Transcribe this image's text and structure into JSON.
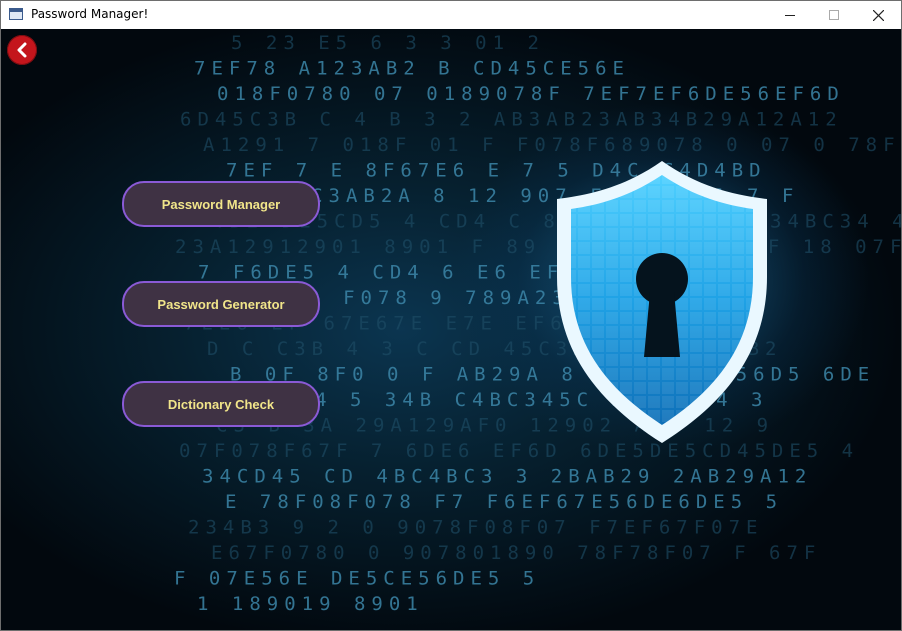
{
  "window": {
    "title": "Password Manager!"
  },
  "buttons": {
    "password_manager": "Password Manager",
    "password_generator": "Password Generator",
    "dictionary_check": "Dictionary Check"
  },
  "background_text": [
    "5 23 E5 6 3 3 01 2",
    "7EF78 A123AB2 B CD45CE56E",
    "018F0780 07 0189078F 7EF7EF6DE56EF6D",
    "6D45C3B C 4 B 3 2 AB3AB23AB34B29A12A12",
    "A1291 7 018F 01 F F078F689078 0 07 0 78F0",
    "7EF 7 E 8F67E6 E 7 5 D4C C4D4BD",
    "0 4 5 3C3AB2A 8 12 907 F7EF78F6 7 F",
    "4B2 DE5CD5 4 CD4 C 8 C4B234B24B 34BC34 4",
    "23A12912901 8901 F 89 6EF6DEF6EF67F 18 07F",
    "7 F6DE5 4 CD4 6 E6 EF6 FF D 67C C",
    "189089 F078 9 789A23 29 07",
    "7EE6 EF 67E67E E7E EF6 D45D4",
    "D C C3B 4 3 C CD 45C3A 4B3 A12AB2",
    "B 0F 8F0 0 F AB29A 8 1 901 7E56D5 6DE",
    "5 CD4BD4 5 34B C4BC345C 34B34 4 3",
    "C3 B 3A 29A129AF0 12902 A12 12 9",
    "07F078F67F 7 6DE6 EF6D 6DE5DE5CD45DE5 4",
    "34CD45 CD 4BC4BC3 3 2BAB29 2AB29A12",
    "E 78F08F078 F7 F6EF67E56DE6DE5 5",
    "234B3 9 2 0 9078F08F07 F7EF67F07E",
    "E67F0780 0 907801890 78F78F07 F 67F",
    "F 07E56E DE5CE56DE5 5",
    "1 189019 8901"
  ]
}
